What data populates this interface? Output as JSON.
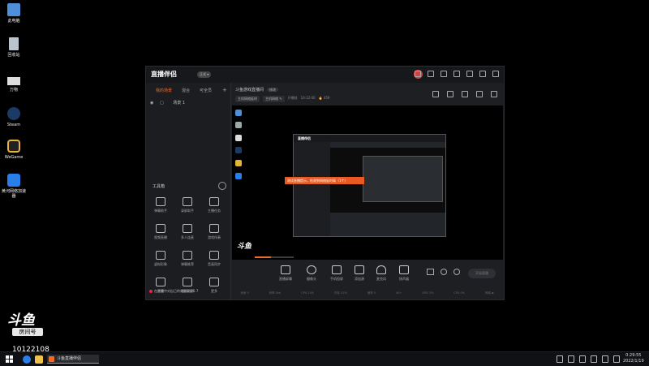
{
  "desktop": {
    "icons": [
      {
        "label": "此电脑",
        "icon": "computer-icon"
      },
      {
        "label": "回收站",
        "icon": "recycle-bin-icon"
      },
      {
        "label": "万物",
        "icon": "everything-icon"
      },
      {
        "label": "Steam",
        "icon": "steam-icon"
      },
      {
        "label": "WeGame",
        "icon": "wegame-icon"
      },
      {
        "label": "黄河网络加速器",
        "icon": "accelerator-icon"
      }
    ]
  },
  "app": {
    "title": "直播伴侣",
    "badge": "正式 ▾",
    "colors": {
      "accent": "#f26a2a",
      "bg": "#1d1f22"
    }
  },
  "left_panel": {
    "tabs": [
      "我的场景",
      "混合",
      "可全员"
    ],
    "add": "+",
    "scene_label": "场景 1",
    "tools_title": "工具箱",
    "tools": [
      "弹幕助手",
      "录屏助手",
      "主播任务",
      "视频直播",
      "多人连麦",
      "游戏伴奏",
      "虚拟形象",
      "弹幕推荐",
      "音画同步",
      "房管",
      "画质检测",
      "更多"
    ],
    "tip": "在直播中对自己的电脑录屏5.7"
  },
  "room": {
    "title": "斗鱼游戏直播间",
    "edit": "修改",
    "chip1": "主机网络延时",
    "chip2": "主机网络 ✎",
    "stat1": "开播前",
    "stat2": "10:12:00",
    "stat3": "🔥 459"
  },
  "stage": {
    "inner_logo": "直播伴侣",
    "banner": "测试直播提示，检测到网络延时高（1个）",
    "logo": "斗鱼"
  },
  "controls": {
    "items": [
      "直播屏幕",
      "摄像头",
      "手机投屏",
      "添加源",
      "麦克风",
      "扬声器"
    ],
    "start_button": "开始直播"
  },
  "statusbar": [
    "丢帧 0",
    "码率 0kb",
    "CPU 14%",
    "内存 52%",
    "帧率 0",
    "4K+",
    "GPU 3%",
    "CPU 0%",
    "网络 ▪"
  ],
  "streamer": {
    "logo": "斗鱼",
    "room_label": "房间号",
    "room_number": "10122108"
  },
  "taskbar": {
    "task_label": "斗鱼直播伴侣",
    "time": "0:29:55",
    "date": "2022/1/19"
  }
}
